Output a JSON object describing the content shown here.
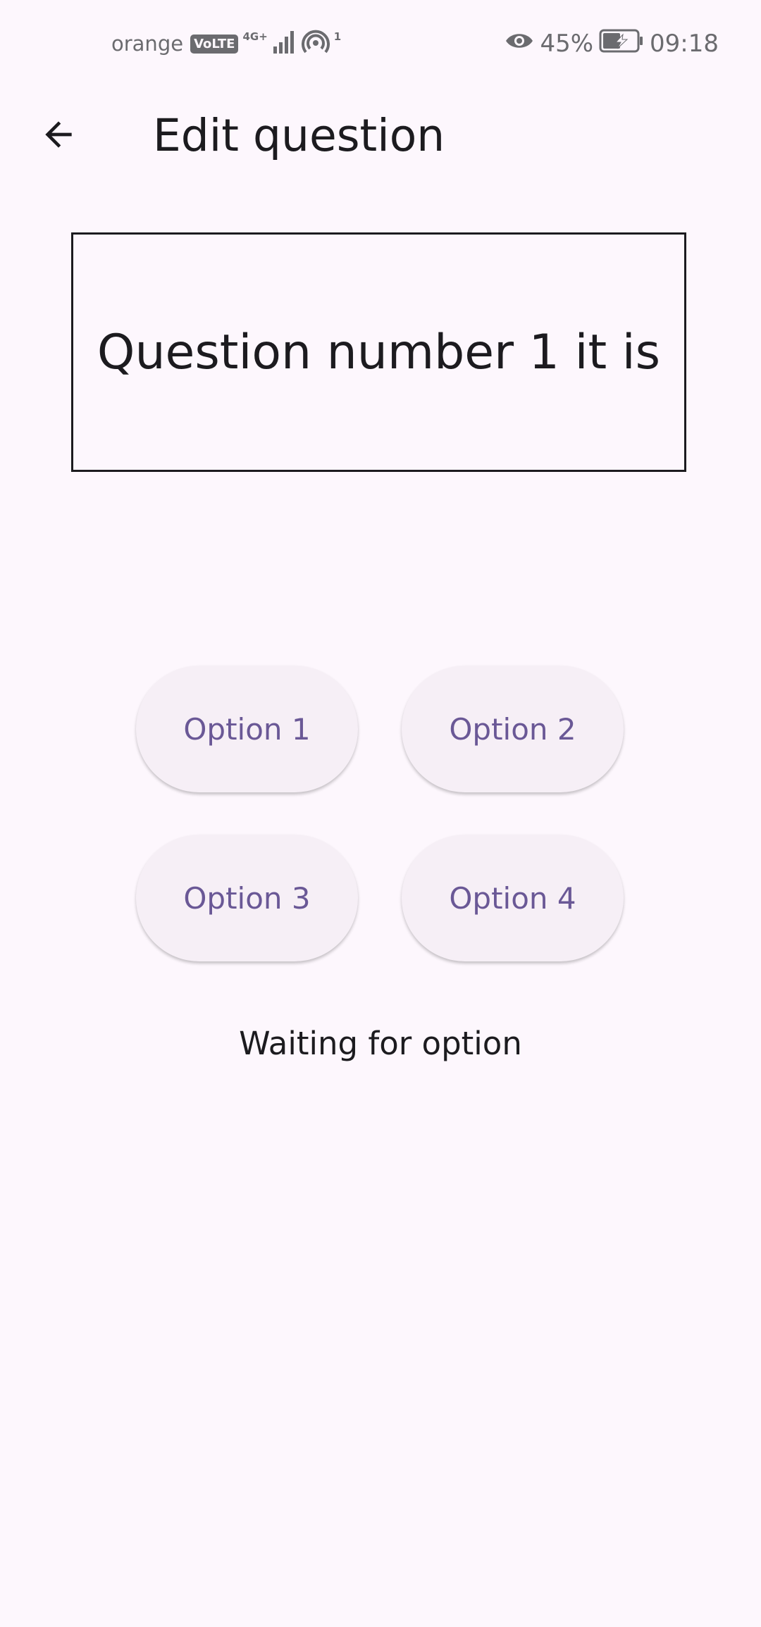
{
  "status_bar": {
    "carrier": "orange",
    "volte": "VoLTE",
    "network": "4G+",
    "hotspot_count": "1",
    "battery": "45%",
    "time": "09:18"
  },
  "app_bar": {
    "title": "Edit question"
  },
  "question": {
    "text": "Question number 1 it is"
  },
  "options": [
    {
      "label": "Option 1"
    },
    {
      "label": "Option 2"
    },
    {
      "label": "Option 3"
    },
    {
      "label": "Option 4"
    }
  ],
  "status_message": "Waiting for option",
  "colors": {
    "background": "#fdf7fd",
    "option_bg": "#f6eff6",
    "option_text": "#6a5896",
    "text": "#1c1b1f"
  }
}
